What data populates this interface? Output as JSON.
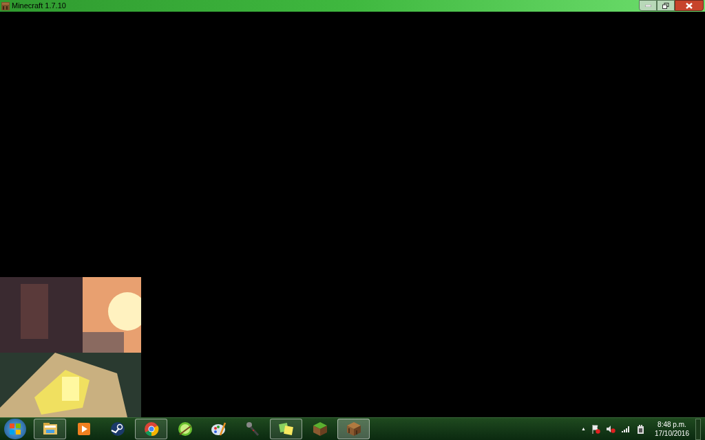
{
  "window": {
    "title": "Minecraft 1.7.10"
  },
  "taskbar": {
    "items": [
      {
        "kind": "folder",
        "open": true,
        "active": false
      },
      {
        "kind": "media",
        "open": false,
        "active": false
      },
      {
        "kind": "steam",
        "open": false,
        "active": false
      },
      {
        "kind": "chrome",
        "open": true,
        "active": false
      },
      {
        "kind": "lime",
        "open": false,
        "active": false
      },
      {
        "kind": "palette",
        "open": false,
        "active": false
      },
      {
        "kind": "mic",
        "open": false,
        "active": false
      },
      {
        "kind": "notes",
        "open": true,
        "active": false
      },
      {
        "kind": "grass",
        "open": false,
        "active": false
      },
      {
        "kind": "table",
        "open": true,
        "active": true
      }
    ],
    "tray_arrow": "▲",
    "clock": {
      "time": "8:48 p.m.",
      "date": "17/10/2016"
    }
  }
}
